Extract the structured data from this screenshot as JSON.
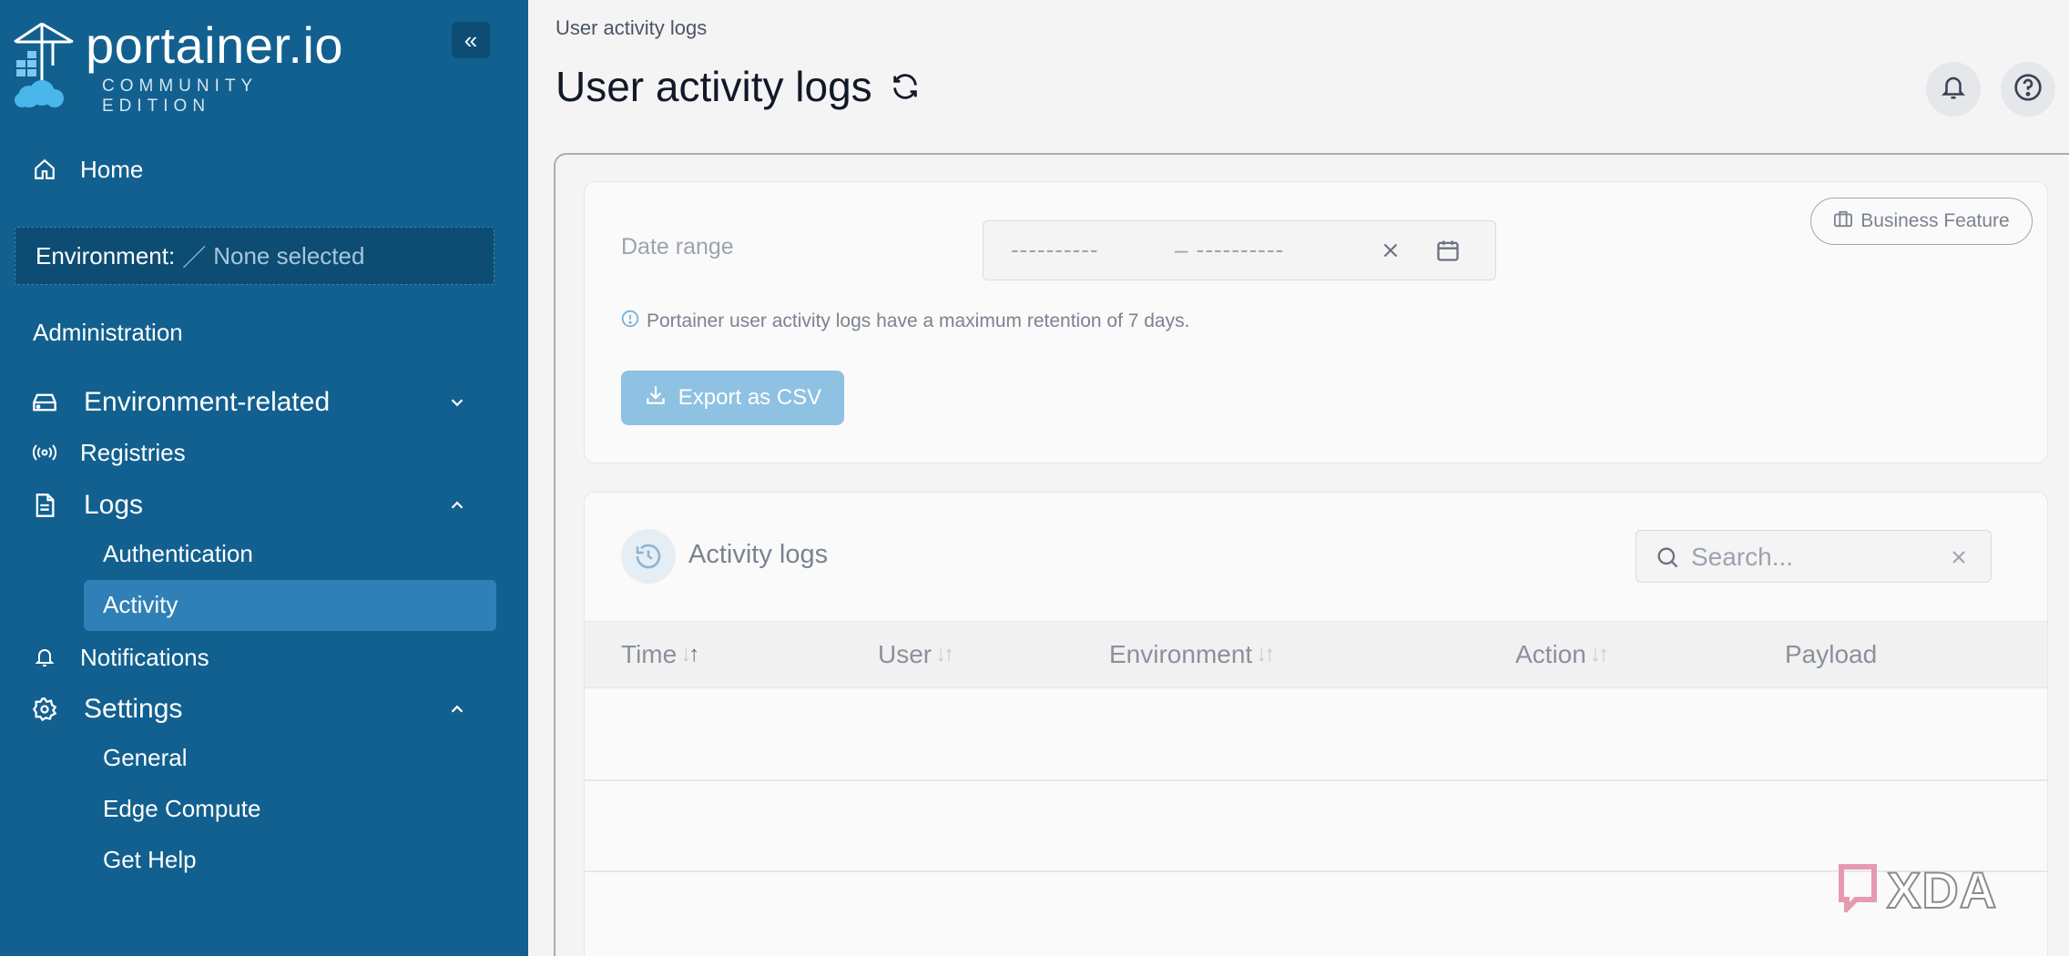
{
  "brand": {
    "name": "portainer.io",
    "edition": "COMMUNITY EDITION",
    "collapse_icon": "double-chevron-left-icon"
  },
  "sidebar": {
    "home_label": "Home",
    "environment_key": "Environment:",
    "environment_value": "None selected",
    "section_title": "Administration",
    "environment_related_label": "Environment-related",
    "registries_label": "Registries",
    "logs_label": "Logs",
    "logs_children": [
      "Authentication",
      "Activity"
    ],
    "notifications_label": "Notifications",
    "settings_label": "Settings",
    "settings_children": [
      "General",
      "Edge Compute",
      "Get Help"
    ],
    "active_item": "Activity",
    "colors": {
      "background": "#12608f",
      "active": "#2e80b6"
    }
  },
  "header": {
    "breadcrumb": "User activity logs",
    "title": "User activity logs"
  },
  "filters": {
    "badge_label": "Business Feature",
    "date_range_label": "Date range",
    "date_start_placeholder": "----------",
    "date_end_placeholder": "– ----------",
    "retention_note": "Portainer user activity logs have a maximum retention of 7 days.",
    "export_label": "Export as CSV"
  },
  "activity": {
    "title": "Activity logs",
    "search_placeholder": "Search...",
    "columns": [
      "Time",
      "User",
      "Environment",
      "Action",
      "Payload"
    ]
  },
  "watermark": "XDA"
}
